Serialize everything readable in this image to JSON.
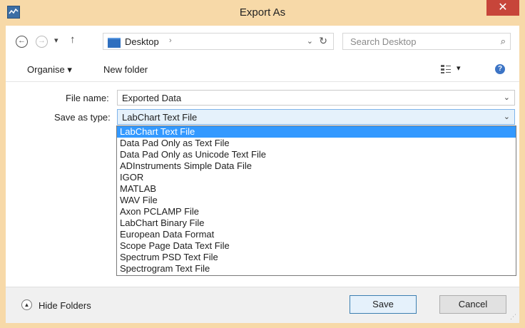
{
  "window": {
    "title": "Export As",
    "close_glyph": "✕"
  },
  "nav": {
    "back_glyph": "←",
    "forward_glyph": "→",
    "recent_glyph": "▾",
    "up_glyph": "↑",
    "address": "Desktop",
    "address_chevron": "›",
    "address_dropdown": "⌄",
    "refresh_glyph": "↻",
    "search_placeholder": "Search Desktop",
    "search_glyph": "⌕"
  },
  "toolbar": {
    "organise_label": "Organise ▾",
    "new_folder_label": "New folder",
    "view_dropdown": "▾",
    "help_glyph": "?"
  },
  "form": {
    "file_name_label": "File name:",
    "file_name_value": "Exported Data",
    "save_type_label": "Save as type:",
    "save_type_value": "LabChart Text File",
    "chevron": "⌄",
    "options": [
      "LabChart Text File",
      "Data Pad Only as Text File",
      "Data Pad Only as Unicode Text File",
      "ADInstruments Simple Data File",
      "IGOR",
      "MATLAB",
      "WAV File",
      "Axon PCLAMP File",
      "LabChart Binary File",
      "European Data Format",
      "Scope Page Data Text File",
      "Spectrum PSD Text File",
      "Spectrogram Text File"
    ]
  },
  "bottom": {
    "hide_folders_glyph": "▲",
    "hide_folders_label": "Hide Folders",
    "save_label": "Save",
    "cancel_label": "Cancel"
  },
  "icons": {
    "app": "app-icon",
    "close": "close-icon",
    "back": "back-arrow-icon",
    "forward": "forward-arrow-icon",
    "up": "up-arrow-icon",
    "folder": "folder-icon",
    "refresh": "refresh-icon",
    "search": "search-icon",
    "view": "view-options-icon",
    "help": "help-icon",
    "hide_folders": "chevron-up-icon"
  },
  "colors": {
    "titlebar": "#f7d9a8",
    "close": "#c7453a",
    "selection": "#3399ff",
    "accent": "#3c7fb1"
  }
}
